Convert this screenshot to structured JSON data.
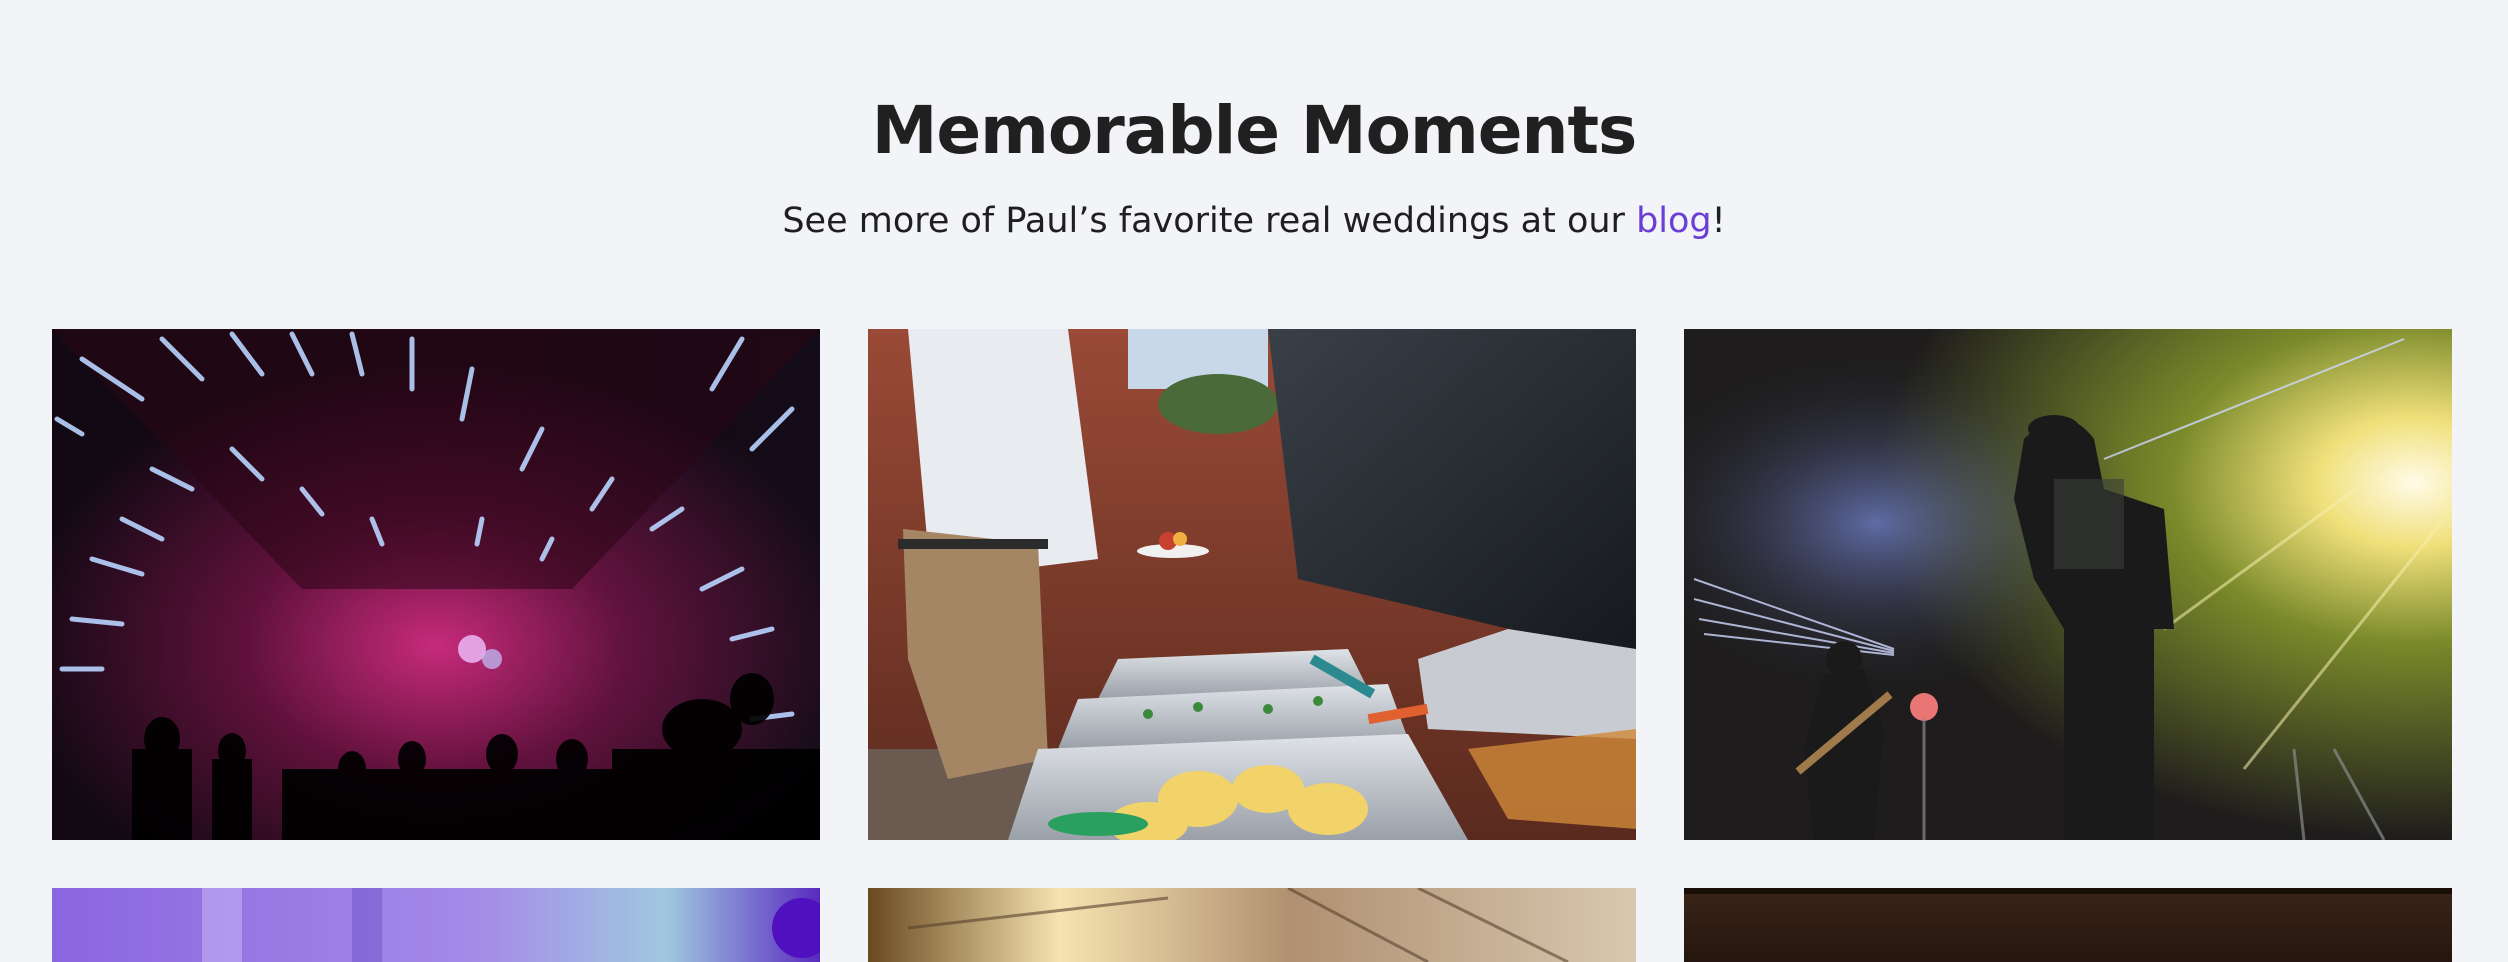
{
  "section": {
    "title": "Memorable Moments",
    "subtitle_before": "See more of Paul’s favorite real weddings at our ",
    "subtitle_link": "blog",
    "subtitle_after": "!"
  },
  "gallery": {
    "photos": [
      {
        "subject": "Party in neon-lit hallway"
      },
      {
        "subject": "Catering buffet with grill"
      },
      {
        "subject": "Live band on stage with lights"
      },
      {
        "subject": "Purple lit reception"
      },
      {
        "subject": "Warm lit tent ceiling"
      },
      {
        "subject": "Dark wood interior"
      }
    ]
  },
  "colors": {
    "background": "#f3f4f8",
    "title": "#202020",
    "link": "#6a3fd6"
  }
}
